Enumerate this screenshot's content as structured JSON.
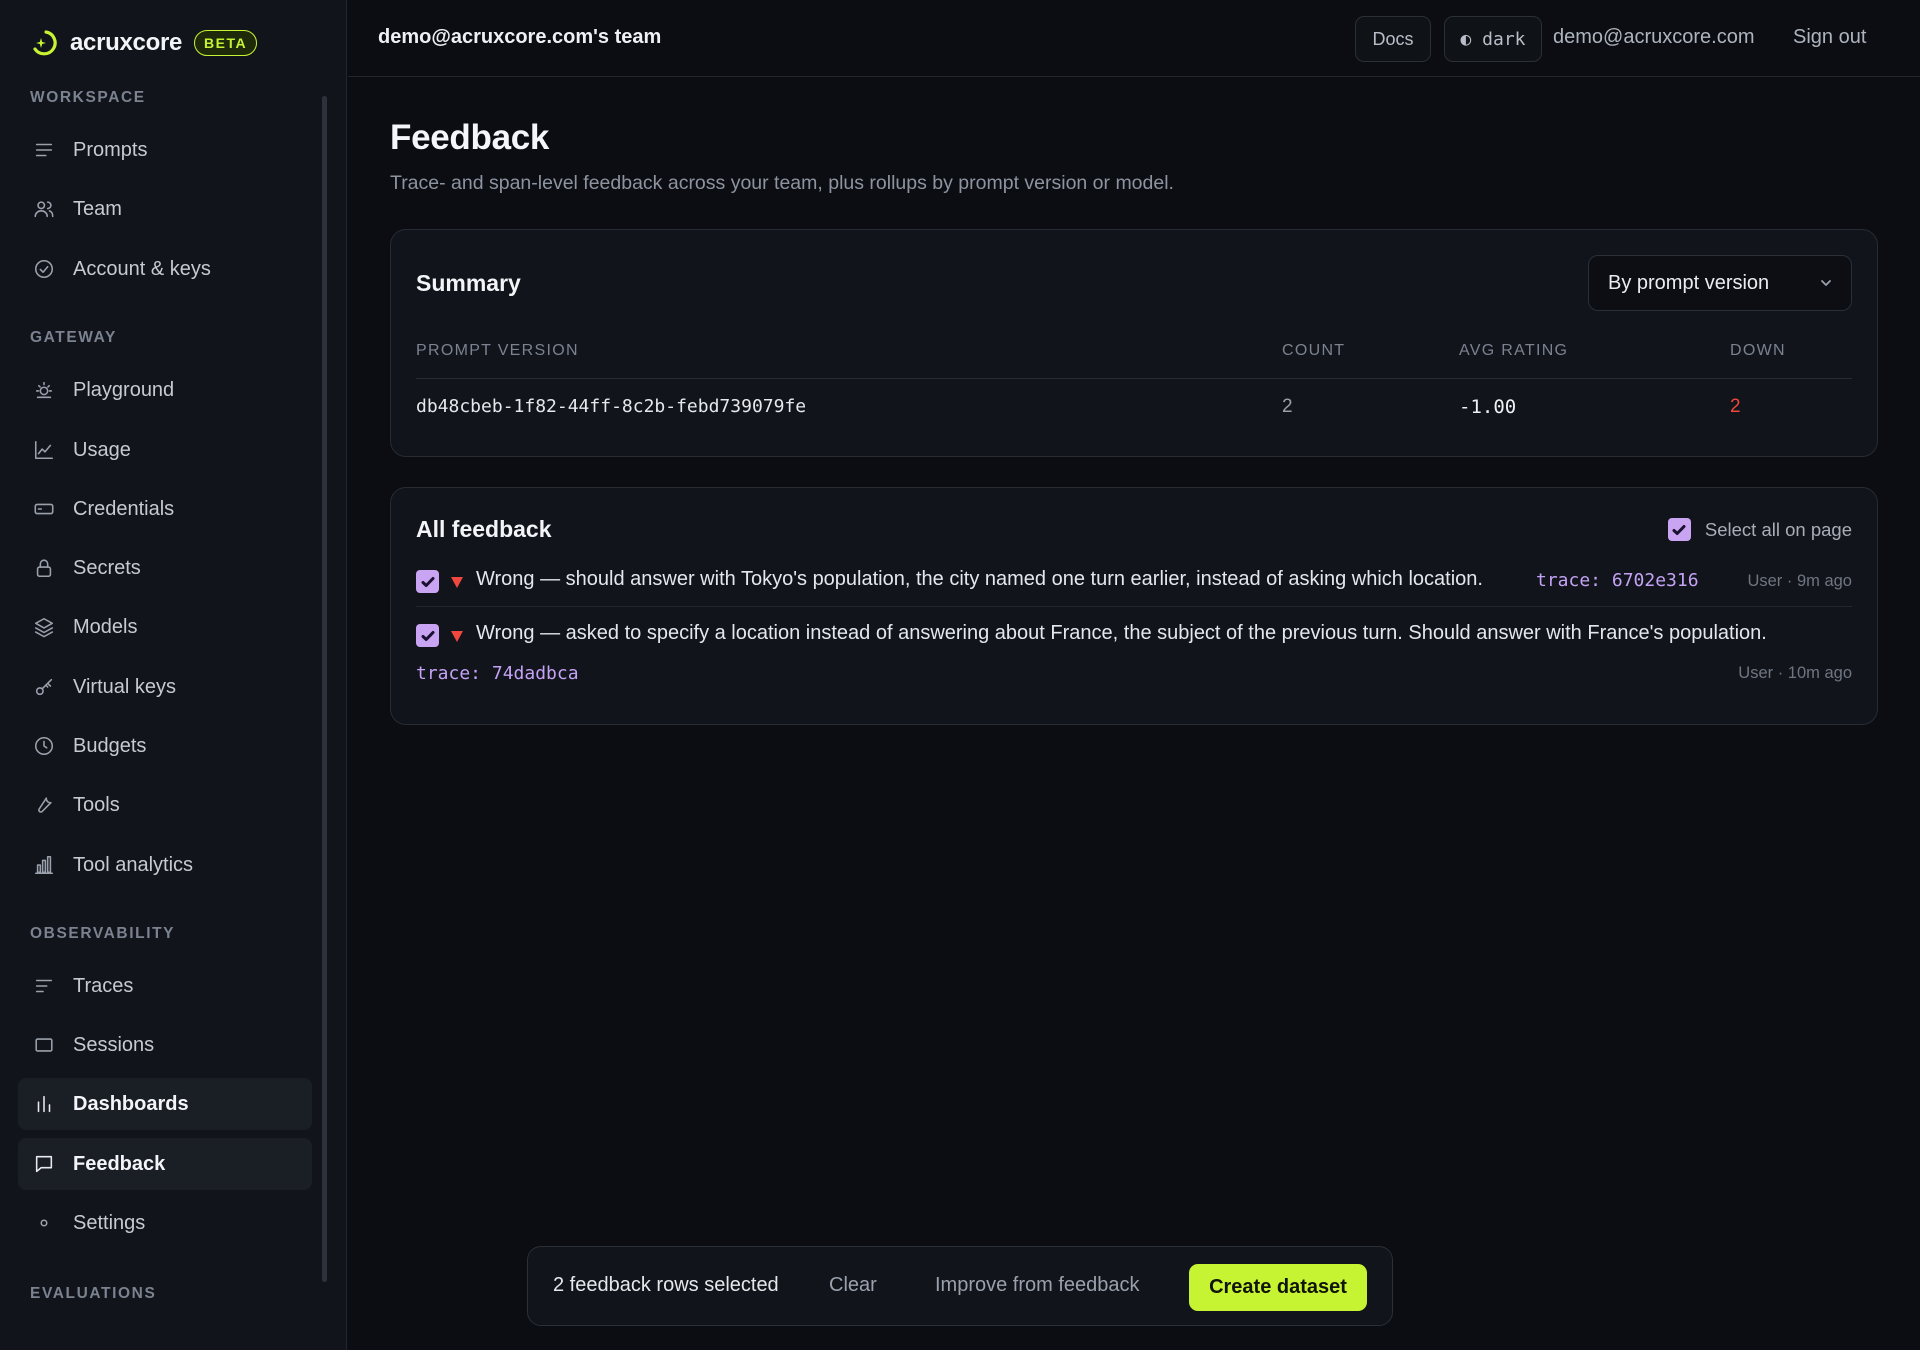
{
  "brand": {
    "name": "acruxcore",
    "badge": "BETA",
    "accent": "#c6f432"
  },
  "sidebar": {
    "sections": [
      {
        "label": "WORKSPACE"
      },
      {
        "label": "GATEWAY"
      },
      {
        "label": "OBSERVABILITY"
      },
      {
        "label": "EVALUATIONS"
      }
    ],
    "items": [
      {
        "label": "Prompts",
        "icon": "list-icon"
      },
      {
        "label": "Team",
        "icon": "users-icon"
      },
      {
        "label": "Account & keys",
        "icon": "check-circle-icon"
      },
      {
        "label": "Playground",
        "icon": "sun-icon"
      },
      {
        "label": "Usage",
        "icon": "line-chart-icon"
      },
      {
        "label": "Credentials",
        "icon": "card-icon"
      },
      {
        "label": "Secrets",
        "icon": "lock-icon"
      },
      {
        "label": "Models",
        "icon": "layers-icon"
      },
      {
        "label": "Virtual keys",
        "icon": "key-icon"
      },
      {
        "label": "Budgets",
        "icon": "clock-icon"
      },
      {
        "label": "Tools",
        "icon": "wrench-icon"
      },
      {
        "label": "Tool analytics",
        "icon": "bar-chart-icon"
      },
      {
        "label": "Traces",
        "icon": "traces-icon"
      },
      {
        "label": "Sessions",
        "icon": "square-icon"
      },
      {
        "label": "Dashboards",
        "icon": "dashboard-icon",
        "highlighted": true
      },
      {
        "label": "Feedback",
        "icon": "message-icon",
        "active": true
      },
      {
        "label": "Settings",
        "icon": "dot-icon"
      }
    ]
  },
  "topbar": {
    "team": "demo@acruxcore.com's team",
    "docs": "Docs",
    "theme_toggle": "◐ dark",
    "user_email": "demo@acruxcore.com",
    "sign_out": "Sign out"
  },
  "page": {
    "title": "Feedback",
    "subtitle": "Trace- and span-level feedback across your team, plus rollups by prompt version or model."
  },
  "summary": {
    "title": "Summary",
    "group_by": "By prompt version",
    "columns": [
      "PROMPT VERSION",
      "COUNT",
      "AVG RATING",
      "DOWN"
    ],
    "rows": [
      {
        "prompt_version": "db48cbeb-1f82-44ff-8c2b-febd739079fe",
        "count": "2",
        "avg_rating": "-1.00",
        "down": "2"
      }
    ],
    "down_color": "#f0483e"
  },
  "all_feedback": {
    "title": "All feedback",
    "select_all": "Select all on page",
    "items": [
      {
        "checked": true,
        "text": "Wrong — should answer with Tokyo's population, the city named one turn earlier, instead of asking which location.",
        "trace": "trace: 6702e316",
        "meta": "User · 9m ago"
      },
      {
        "checked": true,
        "text": "Wrong — asked to specify a location instead of answering about France, the subject of the previous turn. Should answer with France's population.",
        "trace": "trace: 74dadbca",
        "meta": "User · 10m ago"
      }
    ]
  },
  "action_bar": {
    "selected_text": "2 feedback rows selected",
    "clear": "Clear",
    "improve": "Improve from feedback",
    "create": "Create dataset"
  }
}
